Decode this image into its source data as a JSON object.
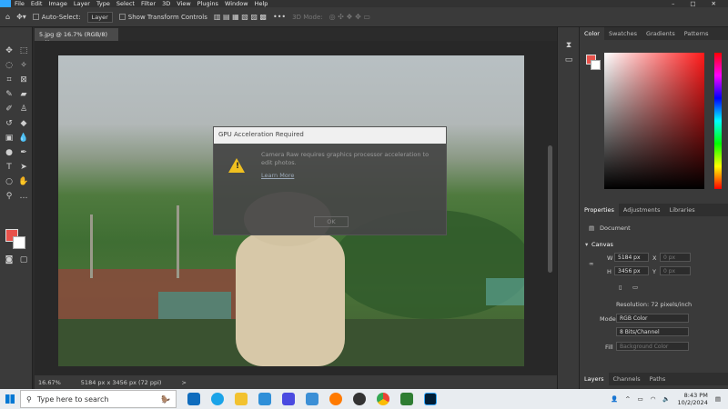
{
  "menu": [
    "File",
    "Edit",
    "Image",
    "Layer",
    "Type",
    "Select",
    "Filter",
    "3D",
    "View",
    "Plugins",
    "Window",
    "Help"
  ],
  "window_controls": [
    "–",
    "□",
    "✕"
  ],
  "options_bar": {
    "auto_select_label": "Auto-Select:",
    "layer_select": "Layer",
    "transform_controls_label": "Show Transform Controls",
    "mode_3d_label": "3D Mode:"
  },
  "document": {
    "tab_label": "5.jpg @ 16.7% (RGB/8)",
    "close_glyph": "×"
  },
  "status": {
    "zoom": "16.67%",
    "doc_info": "5184 px x 3456 px (72 ppi)",
    "arrow": ">"
  },
  "color_panel": {
    "tabs": [
      "Color",
      "Swatches",
      "Gradients",
      "Patterns"
    ]
  },
  "properties_panel": {
    "tabs": [
      "Properties",
      "Adjustments",
      "Libraries"
    ],
    "doc_label": "Document",
    "canvas_label": "Canvas",
    "w_label": "W",
    "w_value": "5184 px",
    "h_label": "H",
    "h_value": "3456 px",
    "x_label": "X",
    "x_value": "0 px",
    "y_label": "Y",
    "y_value": "0 px",
    "resolution": "Resolution: 72 pixels/inch",
    "mode_label": "Mode",
    "mode_value": "RGB Color",
    "bits_value": "8 Bits/Channel",
    "fill_label": "Fill",
    "fill_value": "Background Color"
  },
  "layers_panel": {
    "tabs": [
      "Layers",
      "Channels",
      "Paths"
    ]
  },
  "dialog": {
    "title": "GPU Acceleration Required",
    "message": "Camera Raw requires graphics processor acceleration to edit photos.",
    "link": "Learn More",
    "ok_label": "OK"
  },
  "taskbar": {
    "search_placeholder": "Type here to search",
    "time": "8:43 PM",
    "date": "10/2/2024"
  },
  "colors": {
    "foreground": "#e8524b",
    "background": "#ffffff",
    "accent": "#31a8ff"
  }
}
